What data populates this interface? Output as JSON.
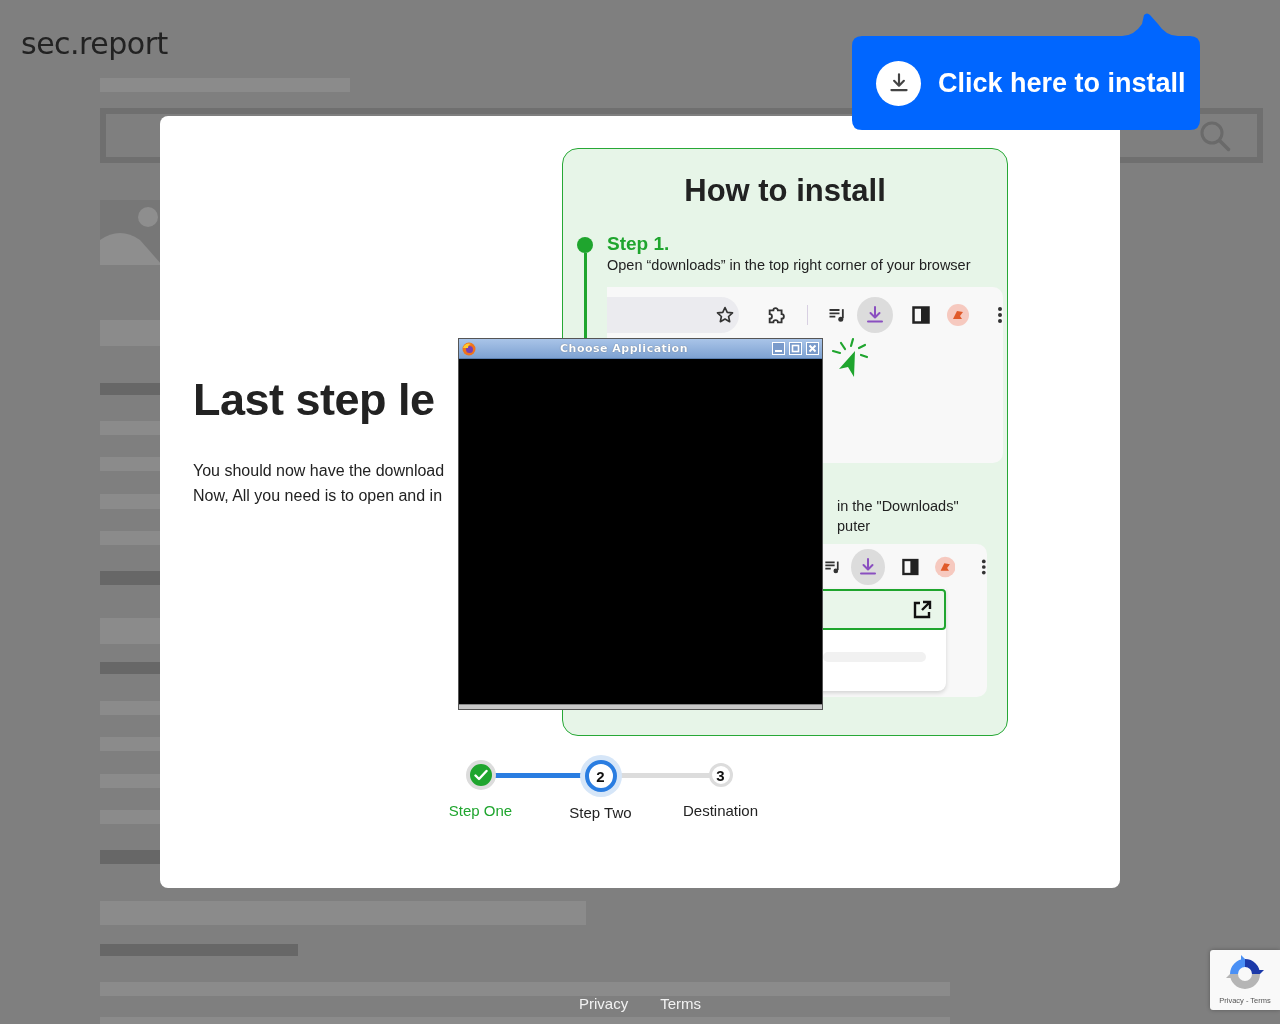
{
  "site": {
    "logo": "sec.report"
  },
  "modal": {
    "heading": "Last step le",
    "body_lines": [
      "You should now have the download",
      "Now, All you need is to open and in"
    ],
    "guide": {
      "title": "How to install",
      "steps": [
        {
          "kind": "toolbar",
          "title": "Step 1.",
          "lines": [
            "Open “downloads” in the top right corner of your browser"
          ]
        },
        {
          "kind": "popup",
          "lines": [
            "in the \"Downloads\"",
            "puter"
          ]
        }
      ]
    },
    "stepper": [
      {
        "label": "Step One",
        "completed": true,
        "selected": false
      },
      {
        "label": "Step Two",
        "number": "2",
        "completed": false,
        "selected": true
      },
      {
        "label": "Destination",
        "number": "3",
        "completed": false,
        "selected": false
      }
    ]
  },
  "dialog": {
    "title": "Choose Application"
  },
  "install_tip": {
    "label": "Click here to install"
  },
  "footer": {
    "links": [
      "Privacy",
      "Terms"
    ]
  },
  "recaptcha": {
    "text": "Privacy - Terms"
  }
}
